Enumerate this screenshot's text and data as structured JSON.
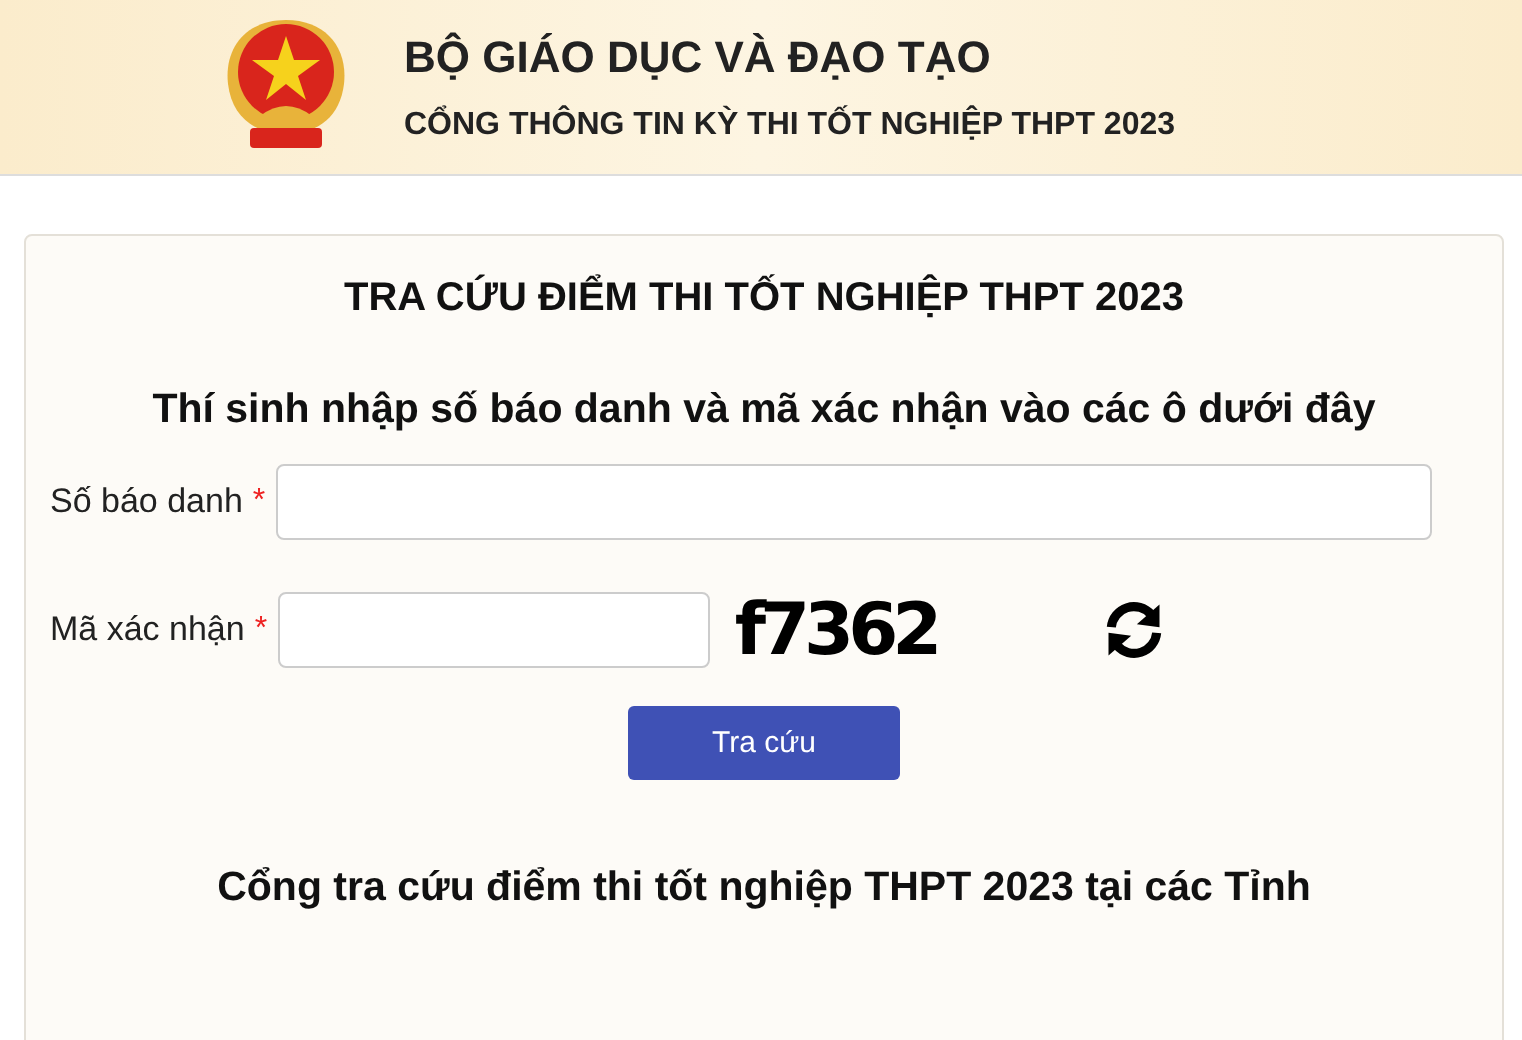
{
  "header": {
    "title": "BỘ GIÁO DỤC VÀ ĐẠO TẠO",
    "subtitle": "CỔNG THÔNG TIN KỲ THI TỐT NGHIỆP THPT 2023"
  },
  "form": {
    "heading": "TRA CỨU ĐIỂM THI TỐT NGHIỆP THPT 2023",
    "instruction": "Thí sinh nhập số báo danh và mã xác nhận vào các ô dưới đây",
    "fields": [
      {
        "label": "Số báo danh",
        "required_mark": "*",
        "kind": "text"
      },
      {
        "label": "Mã xác nhận",
        "required_mark": "*",
        "kind": "captcha",
        "captcha": "f7362"
      }
    ],
    "submit": "Tra cứu"
  },
  "provinces_heading": "Cổng tra cứu điểm thi tốt nghiệp THPT 2023 tại các Tỉnh"
}
